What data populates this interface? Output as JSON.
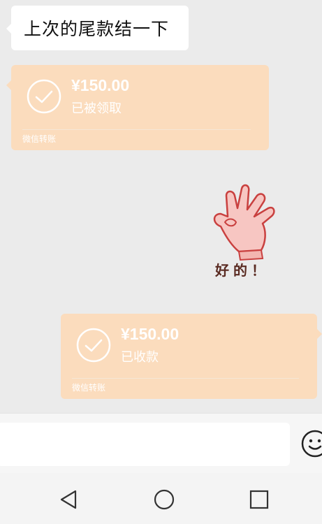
{
  "messages": {
    "text_message": "上次的尾款结一下",
    "transfer_received_by_them": {
      "amount": "¥150.00",
      "status": "已被领取",
      "brand": "微信转账"
    },
    "transfer_received_by_me": {
      "amount": "¥150.00",
      "status": "已收款",
      "brand": "微信转账"
    },
    "sticker_text": "好的！"
  },
  "input": {
    "value": "",
    "placeholder": ""
  },
  "icons": {
    "emoji": "smiley-face-icon",
    "nav_back": "triangle-back-icon",
    "nav_home": "circle-home-icon",
    "nav_recents": "square-recents-icon"
  },
  "colors": {
    "chat_background": "#ebebeb",
    "transfer_card": "#fbdcbd",
    "text_bubble": "#ffffff"
  }
}
